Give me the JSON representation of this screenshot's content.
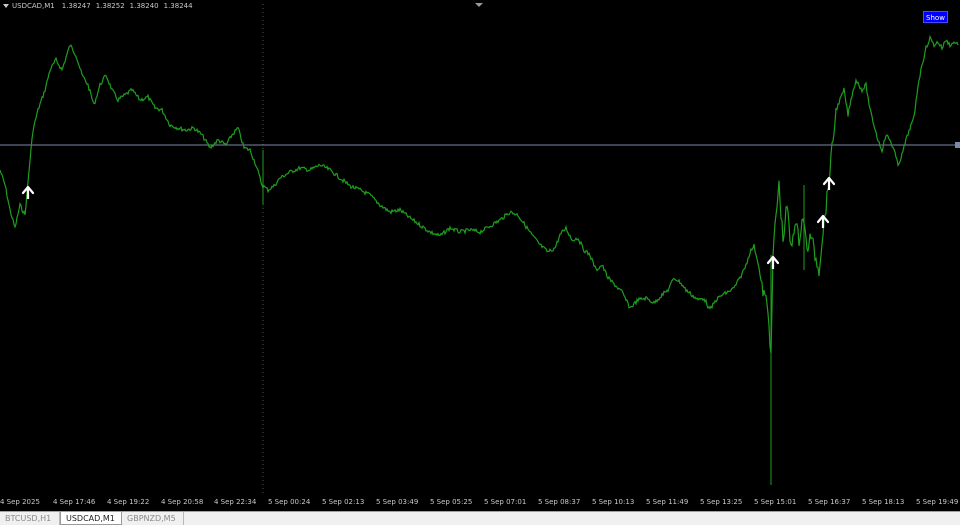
{
  "header": {
    "symbol": "USDCAD,M1",
    "open": "1.38247",
    "high": "1.38252",
    "low": "1.38240",
    "close": "1.38244"
  },
  "show_button": "Show",
  "time_axis": {
    "labels": [
      "4 Sep 2025",
      "4 Sep 17:46",
      "4 Sep 19:22",
      "4 Sep 20:58",
      "4 Sep 22:34",
      "5 Sep 00:24",
      "5 Sep 02:13",
      "5 Sep 03:49",
      "5 Sep 05:25",
      "5 Sep 07:01",
      "5 Sep 08:37",
      "5 Sep 10:13",
      "5 Sep 11:49",
      "5 Sep 13:25",
      "5 Sep 15:01",
      "5 Sep 16:37",
      "5 Sep 18:13",
      "5 Sep 19:49"
    ]
  },
  "tabs": [
    {
      "label": "BTCUSD,H1",
      "active": false
    },
    {
      "label": "USDCAD,M1",
      "active": true
    },
    {
      "label": "GBPNZD,M5",
      "active": false
    }
  ],
  "colors": {
    "background": "#000000",
    "price_line": "#1f9e1f",
    "crosshair": "#7a8aa8",
    "signal_arrow": "#ffffff",
    "show_button": "#0000ff"
  },
  "icons": {
    "signal_arrow": "up-arrow-icon",
    "menu": "dropdown-triangle-icon"
  }
}
